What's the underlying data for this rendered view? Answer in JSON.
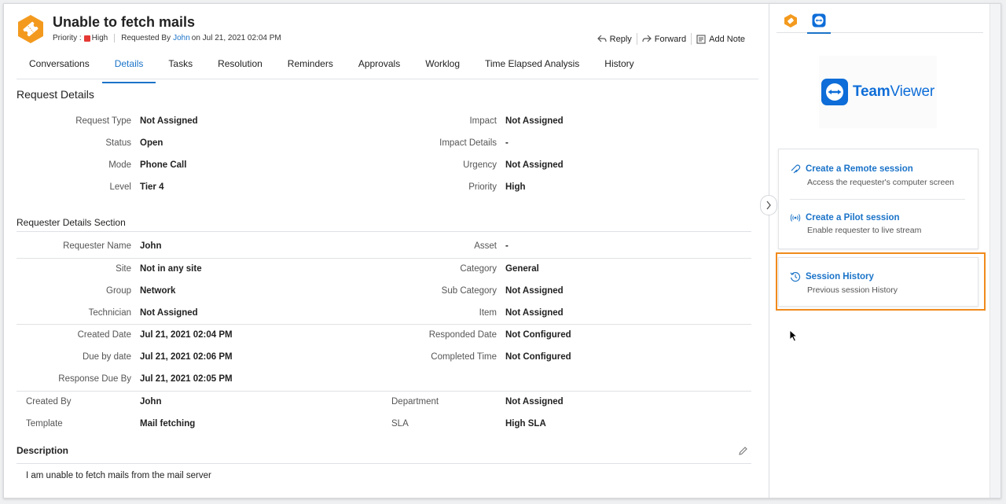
{
  "request": {
    "title": "Unable to fetch mails",
    "priority_label": "Priority :",
    "priority_value": "High",
    "requested_by_label": "Requested By",
    "requester": "John",
    "requested_on": "on Jul 21, 2021 02:04 PM",
    "colors": {
      "priority": "#e53935",
      "accent": "#1a73c8",
      "icon_bg": "#f39a1e",
      "highlight": "#f08a1c"
    }
  },
  "actions": {
    "reply": "Reply",
    "forward": "Forward",
    "add_note": "Add Note"
  },
  "tabs": [
    {
      "label": "Conversations"
    },
    {
      "label": "Details",
      "active": true
    },
    {
      "label": "Tasks"
    },
    {
      "label": "Resolution"
    },
    {
      "label": "Reminders"
    },
    {
      "label": "Approvals"
    },
    {
      "label": "Worklog"
    },
    {
      "label": "Time Elapsed Analysis"
    },
    {
      "label": "History"
    }
  ],
  "request_details": {
    "heading": "Request Details",
    "left": [
      {
        "label": "Request Type",
        "value": "Not Assigned"
      },
      {
        "label": "Status",
        "value": "Open"
      },
      {
        "label": "Mode",
        "value": "Phone Call"
      },
      {
        "label": "Level",
        "value": "Tier 4"
      }
    ],
    "right": [
      {
        "label": "Impact",
        "value": "Not Assigned"
      },
      {
        "label": "Impact Details",
        "value": "-"
      },
      {
        "label": "Urgency",
        "value": "Not Assigned"
      },
      {
        "label": "Priority",
        "value": "High"
      }
    ]
  },
  "requester_details": {
    "heading": "Requester Details Section",
    "rows": [
      {
        "l_label": "Requester Name",
        "l_value": "John",
        "r_label": "Asset",
        "r_value": "-"
      },
      {
        "l_label": "Site",
        "l_value": "Not in any site",
        "r_label": "Category",
        "r_value": "General"
      },
      {
        "l_label": "Group",
        "l_value": "Network",
        "r_label": "Sub Category",
        "r_value": "Not Assigned"
      },
      {
        "l_label": "Technician",
        "l_value": "Not Assigned",
        "r_label": "Item",
        "r_value": "Not Assigned"
      },
      {
        "l_label": "Created Date",
        "l_value": "Jul 21, 2021 02:04 PM",
        "r_label": "Responded Date",
        "r_value": "Not Configured"
      },
      {
        "l_label": "Due by date",
        "l_value": "Jul 21, 2021 02:06 PM",
        "r_label": "Completed Time",
        "r_value": "Not Configured"
      },
      {
        "l_label": "Response Due By",
        "l_value": "Jul 21, 2021 02:05 PM",
        "r_label": "",
        "r_value": ""
      }
    ],
    "extra": [
      {
        "l_label": "Created By",
        "l_value": "John",
        "r_label": "Department",
        "r_value": "Not Assigned"
      },
      {
        "l_label": "Template",
        "l_value": "Mail fetching",
        "r_label": "SLA",
        "r_value": "High SLA"
      }
    ]
  },
  "description": {
    "heading": "Description",
    "text": "I am unable to fetch mails from the mail server"
  },
  "teamviewer": {
    "logo_bold": "Team",
    "logo_rest": "Viewer",
    "remote": {
      "title": "Create a Remote session",
      "desc": "Access the requester's computer screen"
    },
    "pilot": {
      "title": "Create a Pilot session",
      "desc": "Enable requester to live stream"
    },
    "history": {
      "title": "Session History",
      "desc": "Previous session History"
    }
  },
  "icons": [
    "request-icon",
    "reply-icon",
    "forward-icon",
    "note-icon",
    "edit-icon",
    "chevron-right-icon",
    "servicedesk-icon",
    "teamviewer-icon",
    "remote-session-icon",
    "pilot-session-icon",
    "history-icon",
    "mouse-cursor-icon"
  ]
}
